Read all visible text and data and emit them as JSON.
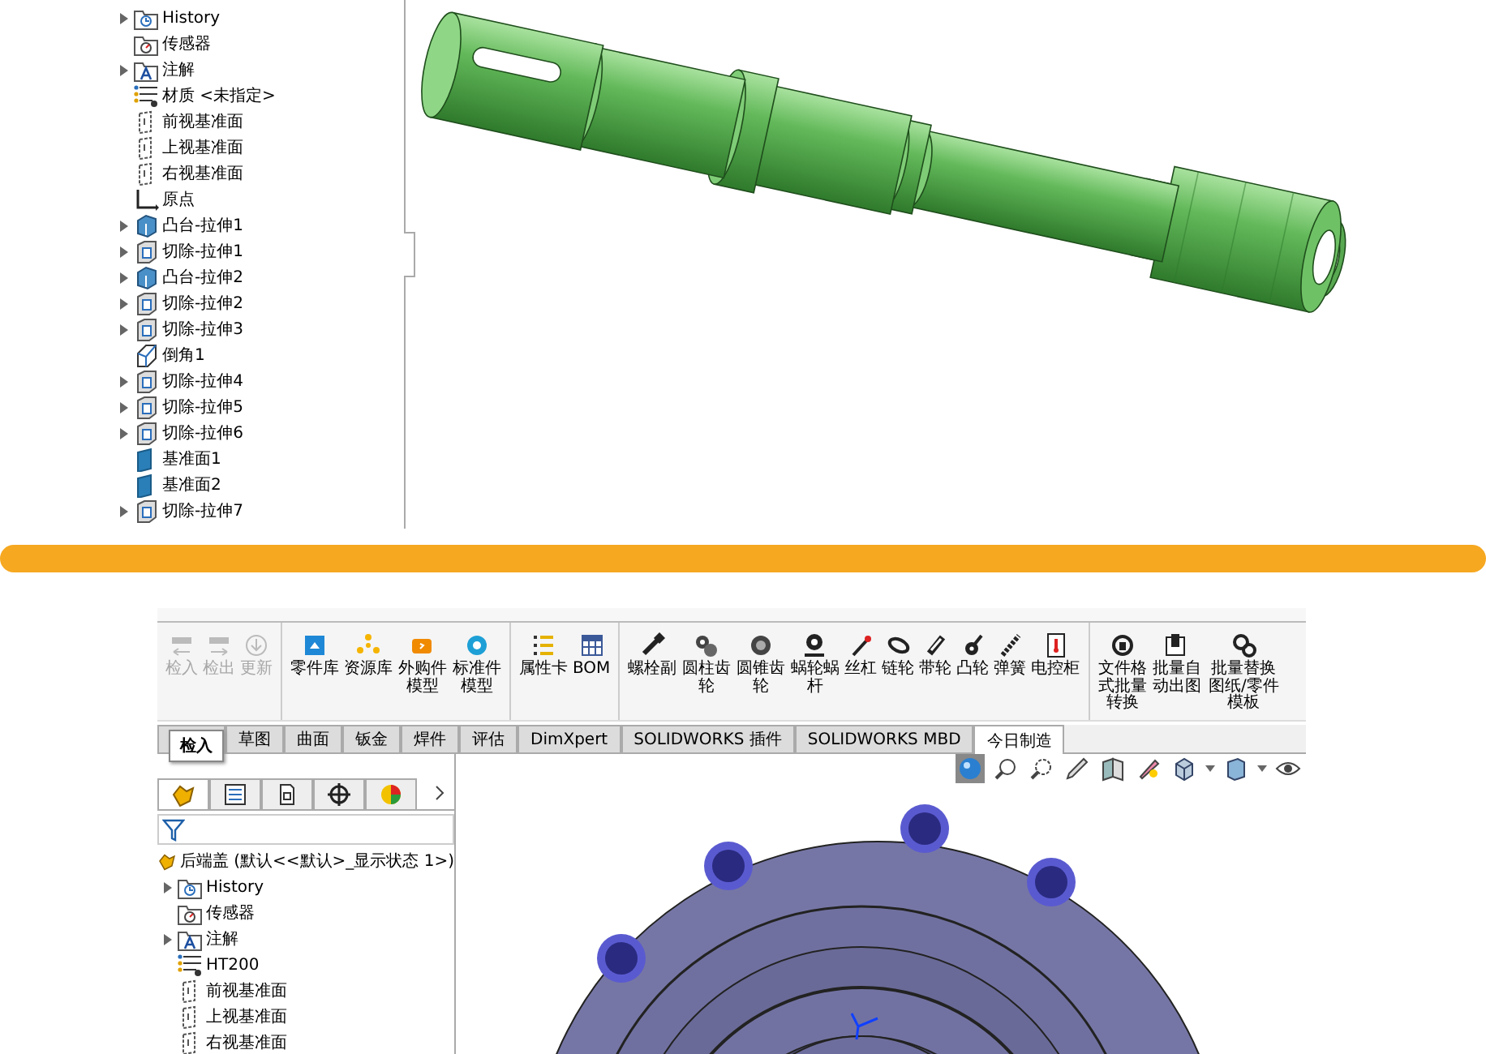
{
  "top": {
    "tree": [
      {
        "label": "History",
        "kind": "history",
        "expandable": true
      },
      {
        "label": "传感器",
        "kind": "sensor",
        "expandable": false
      },
      {
        "label": "注解",
        "kind": "annotation",
        "expandable": true
      },
      {
        "label": "材质 <未指定>",
        "kind": "material",
        "expandable": false
      },
      {
        "label": "前视基准面",
        "kind": "plane",
        "expandable": false
      },
      {
        "label": "上视基准面",
        "kind": "plane",
        "expandable": false
      },
      {
        "label": "右视基准面",
        "kind": "plane",
        "expandable": false
      },
      {
        "label": "原点",
        "kind": "origin",
        "expandable": false
      },
      {
        "label": "凸台-拉伸1",
        "kind": "boss",
        "expandable": true
      },
      {
        "label": "切除-拉伸1",
        "kind": "cut",
        "expandable": true
      },
      {
        "label": "凸台-拉伸2",
        "kind": "boss",
        "expandable": true
      },
      {
        "label": "切除-拉伸2",
        "kind": "cut",
        "expandable": true
      },
      {
        "label": "切除-拉伸3",
        "kind": "cut",
        "expandable": true
      },
      {
        "label": "倒角1",
        "kind": "chamfer",
        "expandable": false
      },
      {
        "label": "切除-拉伸4",
        "kind": "cut",
        "expandable": true
      },
      {
        "label": "切除-拉伸5",
        "kind": "cut",
        "expandable": true
      },
      {
        "label": "切除-拉伸6",
        "kind": "cut",
        "expandable": true
      },
      {
        "label": "基准面1",
        "kind": "refplane",
        "expandable": false
      },
      {
        "label": "基准面2",
        "kind": "refplane",
        "expandable": false
      },
      {
        "label": "切除-拉伸7",
        "kind": "cut",
        "expandable": true
      }
    ]
  },
  "bottom": {
    "toolbar": [
      {
        "buttons": [
          {
            "label": "检入",
            "disabled": true
          },
          {
            "label": "检出",
            "disabled": true
          },
          {
            "label": "更新",
            "disabled": true
          }
        ]
      },
      {
        "buttons": [
          {
            "label": "零件库",
            "disabled": false
          },
          {
            "label": "资源库",
            "disabled": false
          },
          {
            "label": "外购件模型",
            "disabled": false
          },
          {
            "label": "标准件模型",
            "disabled": false
          }
        ]
      },
      {
        "buttons": [
          {
            "label": "属性卡",
            "disabled": false
          },
          {
            "label": "BOM",
            "disabled": false
          }
        ]
      },
      {
        "buttons": [
          {
            "label": "螺栓副",
            "disabled": false
          },
          {
            "label": "圆柱齿轮",
            "disabled": false
          },
          {
            "label": "圆锥齿轮",
            "disabled": false
          },
          {
            "label": "蜗轮蜗杆",
            "disabled": false
          },
          {
            "label": "丝杠",
            "disabled": false
          },
          {
            "label": "链轮",
            "disabled": false
          },
          {
            "label": "带轮",
            "disabled": false
          },
          {
            "label": "凸轮",
            "disabled": false
          },
          {
            "label": "弹簧",
            "disabled": false
          },
          {
            "label": "电控柜",
            "disabled": false
          }
        ]
      },
      {
        "buttons": [
          {
            "label": "文件格式批量转换",
            "disabled": false
          },
          {
            "label": "批量自动出图",
            "disabled": false
          },
          {
            "label": "批量替换图纸/零件模板",
            "disabled": false
          }
        ]
      }
    ],
    "tabs": [
      {
        "label": "草图",
        "selected": false
      },
      {
        "label": "曲面",
        "selected": false
      },
      {
        "label": "钣金",
        "selected": false
      },
      {
        "label": "焊件",
        "selected": false
      },
      {
        "label": "评估",
        "selected": false
      },
      {
        "label": "DimXpert",
        "selected": false
      },
      {
        "label": "SOLIDWORKS 插件",
        "selected": false
      },
      {
        "label": "SOLIDWORKS MBD",
        "selected": false
      },
      {
        "label": "今日制造",
        "selected": true
      }
    ],
    "tooltip": "检入",
    "tree": {
      "root": "后端盖 (默认<<默认>_显示状态 1>)",
      "items": [
        {
          "label": "History",
          "kind": "history",
          "expandable": true
        },
        {
          "label": "传感器",
          "kind": "sensor",
          "expandable": false
        },
        {
          "label": "注解",
          "kind": "annotation",
          "expandable": true
        },
        {
          "label": "HT200",
          "kind": "material",
          "expandable": false
        },
        {
          "label": "前视基准面",
          "kind": "plane",
          "expandable": false
        },
        {
          "label": "上视基准面",
          "kind": "plane",
          "expandable": false
        },
        {
          "label": "右视基准面",
          "kind": "plane",
          "expandable": false
        }
      ]
    }
  }
}
